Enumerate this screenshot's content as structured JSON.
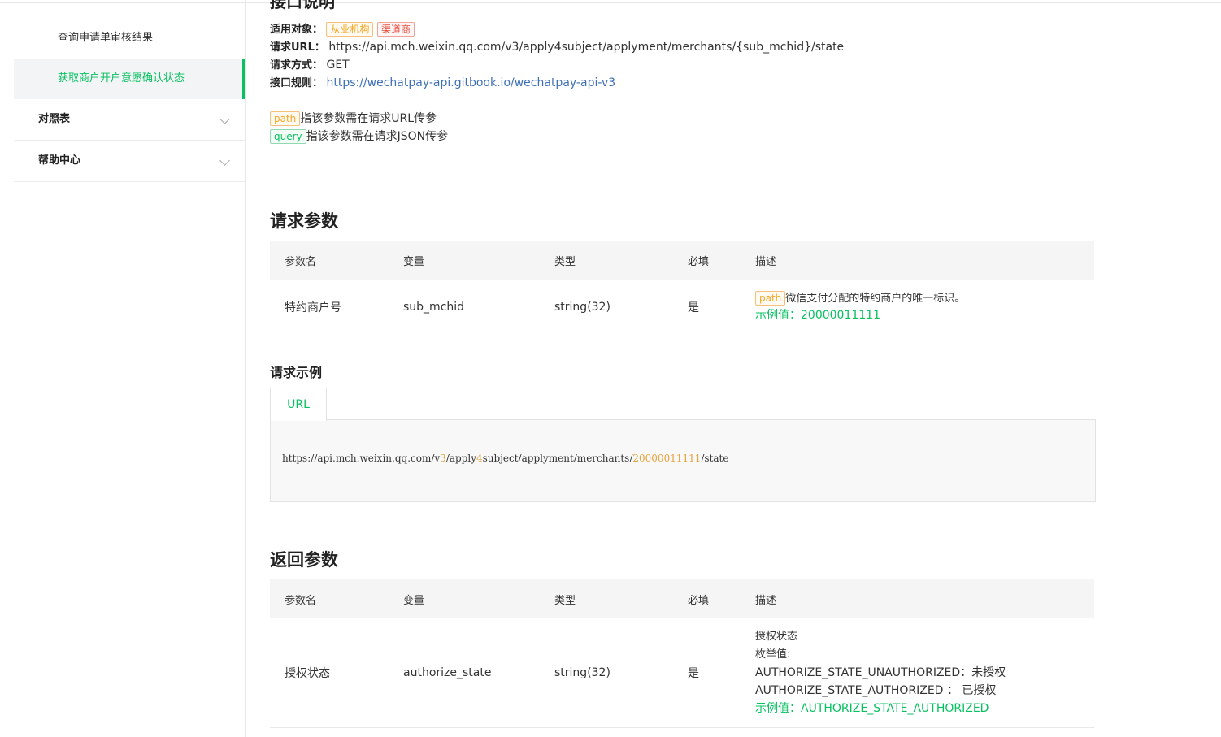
{
  "sidebar": {
    "sub_items": [
      "查询申请单审核结果",
      "获取商户开户意愿确认状态"
    ],
    "groups": [
      "对照表",
      "帮助中心"
    ]
  },
  "doc": {
    "section_cut_title": "接口说明",
    "applicable_label": "适用对象：",
    "applicable_tags": [
      "从业机构",
      "渠道商"
    ],
    "url_label": "请求URL：",
    "url_value": "https://api.mch.weixin.qq.com/v3/apply4subject/applyment/merchants/{sub_mchid}/state",
    "method_label": "请求方式：",
    "method_value": "GET",
    "rule_label": "接口规则：",
    "rule_link": "https://wechatpay-api.gitbook.io/wechatpay-api-v3",
    "path_tag": "path",
    "path_desc": "指该参数需在请求URL传参",
    "query_tag": "query",
    "query_desc": "指该参数需在请求JSON传参"
  },
  "request_params": {
    "title": "请求参数",
    "headers": [
      "参数名",
      "变量",
      "类型",
      "必填",
      "描述"
    ],
    "rows": [
      {
        "name": "特约商户号",
        "var": "sub_mchid",
        "type": "string(32)",
        "required": "是",
        "tag": "path",
        "desc": "微信支付分配的特约商户的唯一标识。",
        "example": "示例值：20000011111"
      }
    ]
  },
  "request_example": {
    "title": "请求示例",
    "tab": "URL",
    "code_parts": [
      "https://api.mch.weixin.qq.com/v",
      "3",
      "/apply",
      "4",
      "subject/applyment/merchants/",
      "20000011111",
      "/state"
    ]
  },
  "response_params": {
    "title": "返回参数",
    "headers": [
      "参数名",
      "变量",
      "类型",
      "必填",
      "描述"
    ],
    "rows": [
      {
        "name": "授权状态",
        "var": "authorize_state",
        "type": "string(32)",
        "required": "是",
        "desc_lines": [
          "授权状态",
          "枚举值:",
          "AUTHORIZE_STATE_UNAUTHORIZED：未授权",
          "AUTHORIZE_STATE_AUTHORIZED ： 已授权"
        ],
        "example": "示例值：AUTHORIZE_STATE_AUTHORIZED"
      }
    ]
  },
  "colors": {
    "accent": "#07c160",
    "link": "#3d6fb6",
    "orange_tag": "#f5a623",
    "red_tag": "#e74c3c"
  }
}
